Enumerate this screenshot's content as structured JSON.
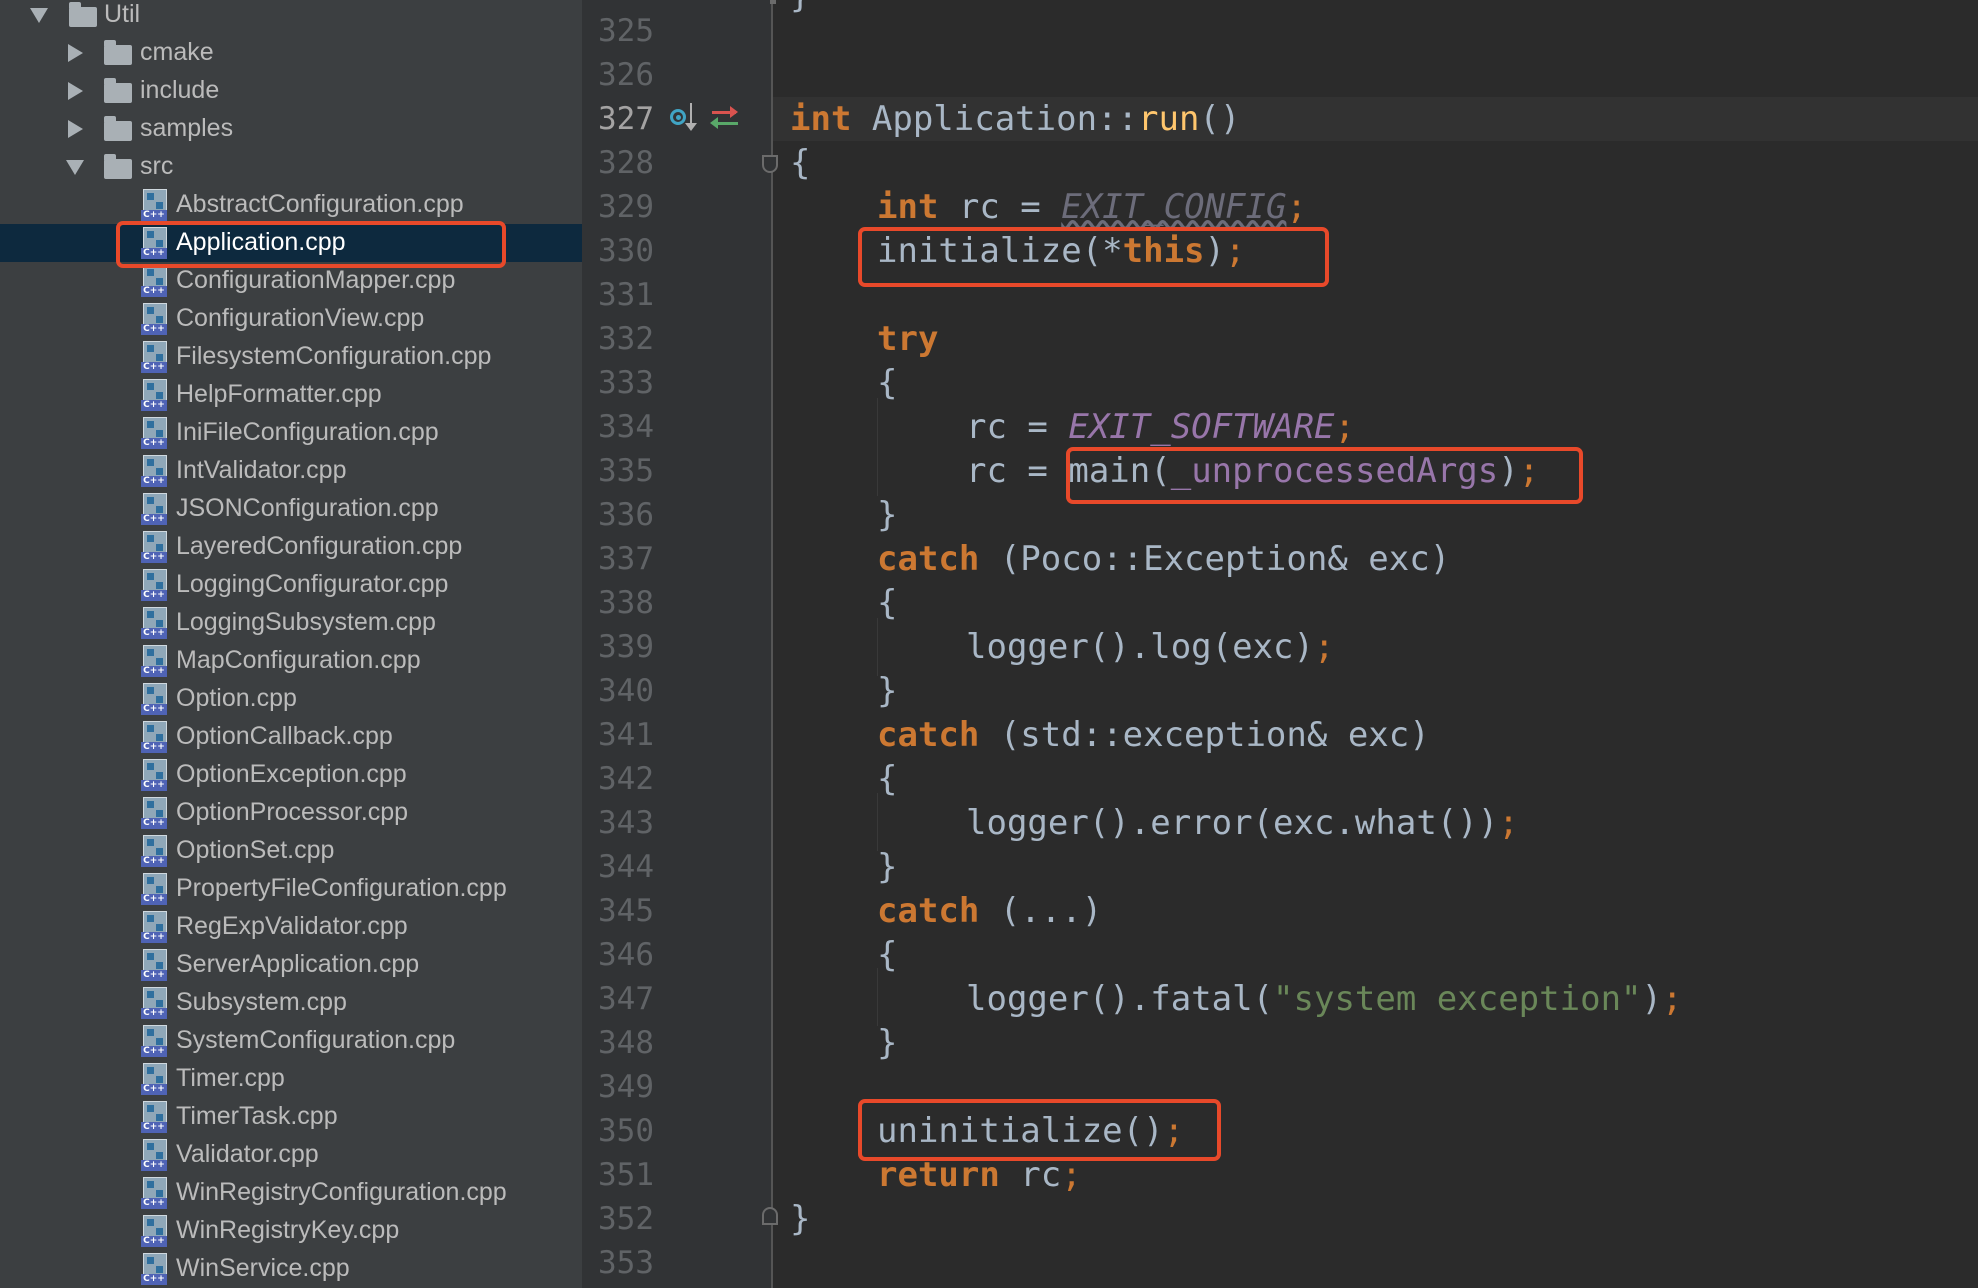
{
  "sidebar": {
    "root": {
      "label": "Util"
    },
    "folders": [
      {
        "label": "cmake"
      },
      {
        "label": "include"
      },
      {
        "label": "samples"
      },
      {
        "label": "src"
      }
    ],
    "icon_badge": "C++",
    "files": [
      {
        "label": "AbstractConfiguration.cpp"
      },
      {
        "label": "Application.cpp"
      },
      {
        "label": "ConfigurationMapper.cpp"
      },
      {
        "label": "ConfigurationView.cpp"
      },
      {
        "label": "FilesystemConfiguration.cpp"
      },
      {
        "label": "HelpFormatter.cpp"
      },
      {
        "label": "IniFileConfiguration.cpp"
      },
      {
        "label": "IntValidator.cpp"
      },
      {
        "label": "JSONConfiguration.cpp"
      },
      {
        "label": "LayeredConfiguration.cpp"
      },
      {
        "label": "LoggingConfigurator.cpp"
      },
      {
        "label": "LoggingSubsystem.cpp"
      },
      {
        "label": "MapConfiguration.cpp"
      },
      {
        "label": "Option.cpp"
      },
      {
        "label": "OptionCallback.cpp"
      },
      {
        "label": "OptionException.cpp"
      },
      {
        "label": "OptionProcessor.cpp"
      },
      {
        "label": "OptionSet.cpp"
      },
      {
        "label": "PropertyFileConfiguration.cpp"
      },
      {
        "label": "RegExpValidator.cpp"
      },
      {
        "label": "ServerApplication.cpp"
      },
      {
        "label": "Subsystem.cpp"
      },
      {
        "label": "SystemConfiguration.cpp"
      },
      {
        "label": "Timer.cpp"
      },
      {
        "label": "TimerTask.cpp"
      },
      {
        "label": "Validator.cpp"
      },
      {
        "label": "WinRegistryConfiguration.cpp"
      },
      {
        "label": "WinRegistryKey.cpp"
      },
      {
        "label": "WinService.cpp"
      }
    ],
    "selected_file": "Application.cpp"
  },
  "gutter": {
    "line_numbers": [
      "325",
      "326",
      "327",
      "328",
      "329",
      "330",
      "331",
      "332",
      "333",
      "334",
      "335",
      "336",
      "337",
      "338",
      "339",
      "340",
      "341",
      "342",
      "343",
      "344",
      "345",
      "346",
      "347",
      "348",
      "349",
      "350",
      "351",
      "352",
      "353"
    ],
    "current_line": "327",
    "icons": [
      "override-method-icon",
      "navigate-related-icon"
    ]
  },
  "code": {
    "l327": {
      "t1": "int",
      "t2": " Application::",
      "t3": "run",
      "t4": "()"
    },
    "l328": {
      "t1": "{"
    },
    "l329": {
      "t1": "int",
      "t2": " rc = ",
      "t3": "EXIT_CONFIG",
      "t4": ";"
    },
    "l330": {
      "t1": "initialize(*",
      "t2": "this",
      "t3": ")",
      "t4": ";"
    },
    "l332": {
      "t1": "try"
    },
    "l333": {
      "t1": "{"
    },
    "l334": {
      "t1": "rc = ",
      "t2": "EXIT_SOFTWARE",
      "t3": ";"
    },
    "l335": {
      "t1": "rc = ",
      "t2": "main(",
      "t3": "_unprocessedArgs",
      "t4": ")",
      "t5": ";"
    },
    "l336": {
      "t1": "}"
    },
    "l337": {
      "t1": "catch",
      "t2": " (Poco::Exception& exc)"
    },
    "l338": {
      "t1": "{"
    },
    "l339": {
      "t1": "logger().log(exc)",
      "t2": ";"
    },
    "l340": {
      "t1": "}"
    },
    "l341": {
      "t1": "catch",
      "t2": " (std::exception& exc)"
    },
    "l342": {
      "t1": "{"
    },
    "l343": {
      "t1": "logger().error(exc.what())",
      "t2": ";"
    },
    "l344": {
      "t1": "}"
    },
    "l345": {
      "t1": "catch",
      "t2": " (...)"
    },
    "l346": {
      "t1": "{"
    },
    "l347": {
      "t1": "logger().fatal(",
      "t2": "\"system exception\"",
      "t3": ")",
      "t4": ";"
    },
    "l348": {
      "t1": "}"
    },
    "l350": {
      "t1": "uninitialize()",
      "t2": ";"
    },
    "l351": {
      "t1": "return",
      "t2": " rc",
      "t3": ";"
    },
    "l352": {
      "t1": "}"
    }
  },
  "colors": {
    "highlight_box": "#e8492a",
    "keyword": "#cc7832",
    "constant": "#9876aa",
    "string": "#6a8759",
    "function_decl": "#ffc66d"
  }
}
